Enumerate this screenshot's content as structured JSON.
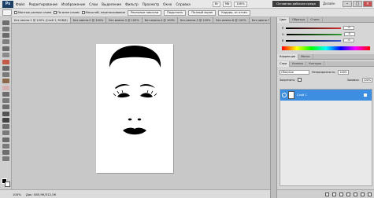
{
  "app": {
    "logo": "Ps"
  },
  "menu": {
    "items": [
      "Файл",
      "Редактирование",
      "Изображение",
      "Слои",
      "Выделение",
      "Фильтр",
      "Просмотр",
      "Окно",
      "Справка"
    ],
    "right": [
      "Br",
      "Mb",
      "100%"
    ]
  },
  "workspace": {
    "button_label": "Основная рабочая среда",
    "design_label": "Дизайн"
  },
  "window_controls": [
    "–",
    "□",
    "×"
  ],
  "options_bar": {
    "checkboxes": [
      "Монтаж разных слоев",
      "По всем слоям",
      "Масштаб, перетаскивание"
    ],
    "buttons": [
      "Реальные пиксели",
      "Подогнать",
      "Полный экран",
      "Кадрир. от отпеч"
    ]
  },
  "document_tabs": [
    {
      "label": "Без имени-1 @ 100% (Слой 1, RGB/8)",
      "active": true
    },
    {
      "label": "Без имени-2 @ 100%",
      "active": false
    },
    {
      "label": "Без имени-3 @ 100%",
      "active": false
    },
    {
      "label": "Без имени-4 @ 100%",
      "active": false
    },
    {
      "label": "Без имени-5 @ 100%",
      "active": false
    },
    {
      "label": "Без имени-6 @ 100%",
      "active": false
    },
    {
      "label": "Без имени-7 @ 100%",
      "active": false
    }
  ],
  "status_bar": {
    "zoom": "100%",
    "doc_info": "Док: 585,9К/312,5К"
  },
  "color_panel": {
    "tabs": [
      "Цвет",
      "Образцы",
      "Стили"
    ],
    "sliders": [
      {
        "label": "R",
        "value": "0",
        "color": "#d03030"
      },
      {
        "label": "G",
        "value": "0",
        "color": "#30a030"
      },
      {
        "label": "B",
        "value": "0",
        "color": "#3050d0"
      }
    ]
  },
  "adjustments_panel": {
    "tabs": [
      "Коррекция",
      "Маски"
    ]
  },
  "layers_panel": {
    "tabs": [
      "Слои",
      "Каналы",
      "Контуры"
    ],
    "blend_mode": "Обычные",
    "opacity_label": "Непрозрачность:",
    "opacity_value": "100%",
    "lock_label": "Закрепить:",
    "fill_label": "Заливка:",
    "fill_value": "100%",
    "layer_name": "Слой 1",
    "selected_color": "#3d8ee0"
  }
}
